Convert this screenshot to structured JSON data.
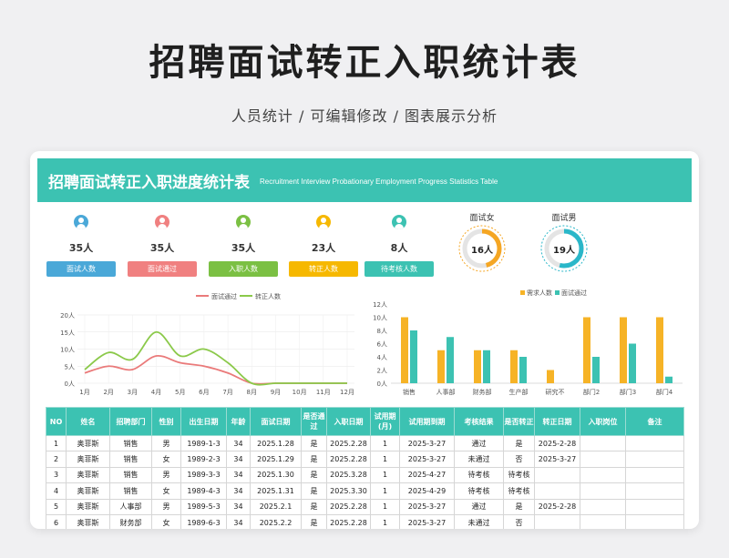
{
  "page": {
    "title": "招聘面试转正入职统计表",
    "subtitle": "人员统计 /  可编辑修改  /  图表展示分析"
  },
  "sheet": {
    "title": "招聘面试转正入职进度统计表",
    "title_en": "Recruitment Interview Probationary Employment Progress Statistics Table"
  },
  "stats": [
    {
      "count": "35人",
      "label": "面试人数",
      "color": "#4aa8d8"
    },
    {
      "count": "35人",
      "label": "面试通过",
      "color": "#f08080"
    },
    {
      "count": "35人",
      "label": "入职人数",
      "color": "#7bc043"
    },
    {
      "count": "23人",
      "label": "转正人数",
      "color": "#f6b800"
    },
    {
      "count": "8人",
      "label": "待考核人数",
      "color": "#3cc2b2"
    }
  ],
  "rings": [
    {
      "label": "面试女",
      "value": "16人",
      "fraction": 0.46,
      "color": "#f5a623"
    },
    {
      "label": "面试男",
      "value": "19人",
      "fraction": 0.54,
      "color": "#2ab7c9"
    }
  ],
  "chart_data": [
    {
      "type": "line",
      "categories": [
        "1月",
        "2月",
        "3月",
        "4月",
        "5月",
        "6月",
        "7月",
        "8月",
        "9月",
        "10月",
        "11月",
        "12月"
      ],
      "ylim": [
        0,
        20
      ],
      "yticks": [
        "0人",
        "5人",
        "10人",
        "15人",
        "20人"
      ],
      "series": [
        {
          "name": "面试通过",
          "color": "#ea7a7a",
          "values": [
            3,
            5,
            4,
            8,
            6,
            5,
            3,
            0,
            0,
            0,
            0,
            0
          ]
        },
        {
          "name": "转正人数",
          "color": "#8bc94a",
          "values": [
            4,
            9,
            7,
            15,
            8,
            10,
            6,
            0,
            0,
            0,
            0,
            0
          ]
        }
      ],
      "legend": "top"
    },
    {
      "type": "bar",
      "categories": [
        "销售",
        "人事部",
        "财务部",
        "生产部",
        "研究不",
        "部门2",
        "部门3",
        "部门4"
      ],
      "ylim": [
        0,
        12
      ],
      "yticks": [
        "0人",
        "2人",
        "4人",
        "6人",
        "8人",
        "10人",
        "12人"
      ],
      "series": [
        {
          "name": "需求人数",
          "color": "#f6b326",
          "values": [
            10,
            5,
            5,
            5,
            2,
            10,
            10,
            10
          ]
        },
        {
          "name": "面试通过",
          "color": "#3cc2b2",
          "values": [
            8,
            7,
            5,
            4,
            0,
            4,
            6,
            1
          ]
        }
      ],
      "legend": "top"
    }
  ],
  "table": {
    "headers": [
      "NO",
      "姓名",
      "招聘部门",
      "性别",
      "出生日期",
      "年龄",
      "面试日期",
      "是否通过",
      "入职日期",
      "试用期(月)",
      "试用期到期",
      "考核结果",
      "是否转正",
      "转正日期",
      "入职岗位",
      "备注"
    ],
    "rows": [
      [
        "1",
        "奥菲斯",
        "销售",
        "男",
        "1989-1-3",
        "34",
        "2025.1.28",
        "是",
        "2025.2.28",
        "1",
        "2025-3-27",
        "通过",
        "是",
        "2025-2-28",
        "",
        ""
      ],
      [
        "2",
        "奥菲斯",
        "销售",
        "女",
        "1989-2-3",
        "34",
        "2025.1.29",
        "是",
        "2025.2.28",
        "1",
        "2025-3-27",
        "未通过",
        "否",
        "2025-3-27",
        "",
        ""
      ],
      [
        "3",
        "奥菲斯",
        "销售",
        "男",
        "1989-3-3",
        "34",
        "2025.1.30",
        "是",
        "2025.3.28",
        "1",
        "2025-4-27",
        "待考核",
        "待考核",
        "",
        "",
        ""
      ],
      [
        "4",
        "奥菲斯",
        "销售",
        "女",
        "1989-4-3",
        "34",
        "2025.1.31",
        "是",
        "2025.3.30",
        "1",
        "2025-4-29",
        "待考核",
        "待考核",
        "",
        "",
        ""
      ],
      [
        "5",
        "奥菲斯",
        "人事部",
        "男",
        "1989-5-3",
        "34",
        "2025.2.1",
        "是",
        "2025.2.28",
        "1",
        "2025-3-27",
        "通过",
        "是",
        "2025-2-28",
        "",
        ""
      ],
      [
        "6",
        "奥菲斯",
        "财务部",
        "女",
        "1989-6-3",
        "34",
        "2025.2.2",
        "是",
        "2025.2.28",
        "1",
        "2025-3-27",
        "未通过",
        "否",
        "",
        "",
        ""
      ]
    ]
  }
}
